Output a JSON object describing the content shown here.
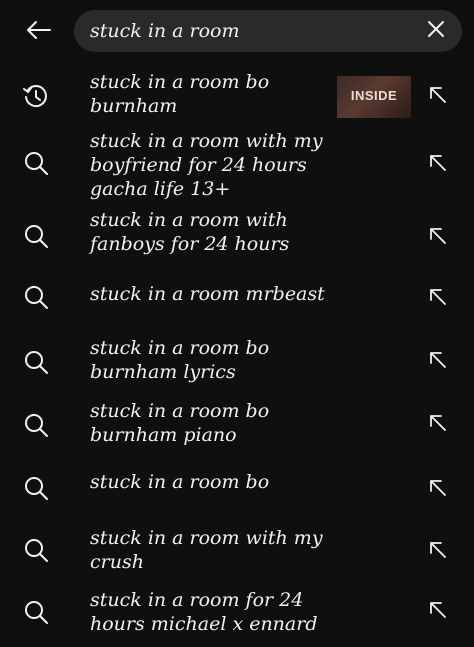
{
  "search": {
    "value": "stuck in a room",
    "placeholder": ""
  },
  "suggestions": [
    {
      "type": "history",
      "icon": "history-icon",
      "text": "stuck in a room bo burnham",
      "thumbnail": {
        "label": "INSIDE"
      }
    },
    {
      "type": "search",
      "icon": "search-icon",
      "text": "stuck in a room with my boyfriend for 24 hours gacha life 13+"
    },
    {
      "type": "search",
      "icon": "search-icon",
      "text": "stuck in a room with fanboys for 24 hours"
    },
    {
      "type": "search",
      "icon": "search-icon",
      "text": "stuck in a room mrbeast"
    },
    {
      "type": "search",
      "icon": "search-icon",
      "text": "stuck in a room bo burnham lyrics"
    },
    {
      "type": "search",
      "icon": "search-icon",
      "text": "stuck in a room bo burnham piano"
    },
    {
      "type": "search",
      "icon": "search-icon",
      "text": "stuck in a room bo"
    },
    {
      "type": "search",
      "icon": "search-icon",
      "text": "stuck in a room with my crush"
    },
    {
      "type": "search",
      "icon": "search-icon",
      "text": "stuck in a room for 24 hours michael x ennard"
    }
  ],
  "colors": {
    "background": "#0f0f0f",
    "search_box": "#2a2a2a",
    "text": "#f1f1f1",
    "icon": "#f1f1f1"
  }
}
